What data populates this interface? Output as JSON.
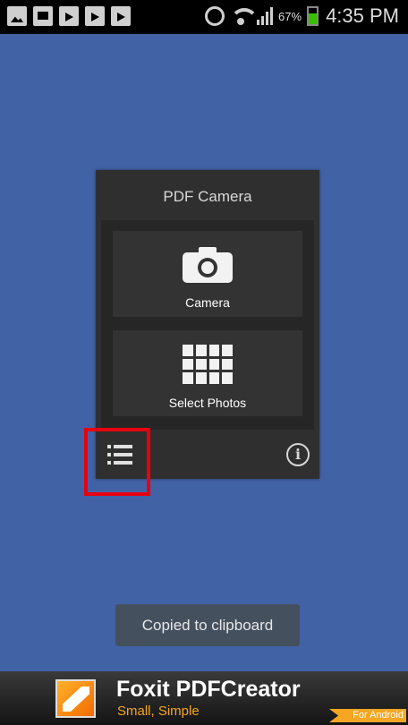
{
  "status_bar": {
    "battery_percent": "67%",
    "battery_level": 0.67,
    "time": "4:35 PM",
    "icons": [
      "picture-icon",
      "sd-card-icon",
      "shopping-bag-icon",
      "shopping-bag-icon",
      "shopping-bag-icon",
      "alarm-icon",
      "wifi-icon",
      "signal-icon",
      "battery-icon"
    ]
  },
  "dialog": {
    "title": "PDF Camera",
    "camera_label": "Camera",
    "photos_label": "Select Photos",
    "menu_icon": "list-icon",
    "info_icon": "info-icon",
    "info_glyph": "i"
  },
  "toast": {
    "message": "Copied to clipboard"
  },
  "ad": {
    "title": "Foxit PDFCreator",
    "subtitle": "Small, Simple",
    "tag": "For Android"
  },
  "colors": {
    "background": "#4262a6",
    "highlight": "#e8000f",
    "accent": "#f5a623"
  }
}
